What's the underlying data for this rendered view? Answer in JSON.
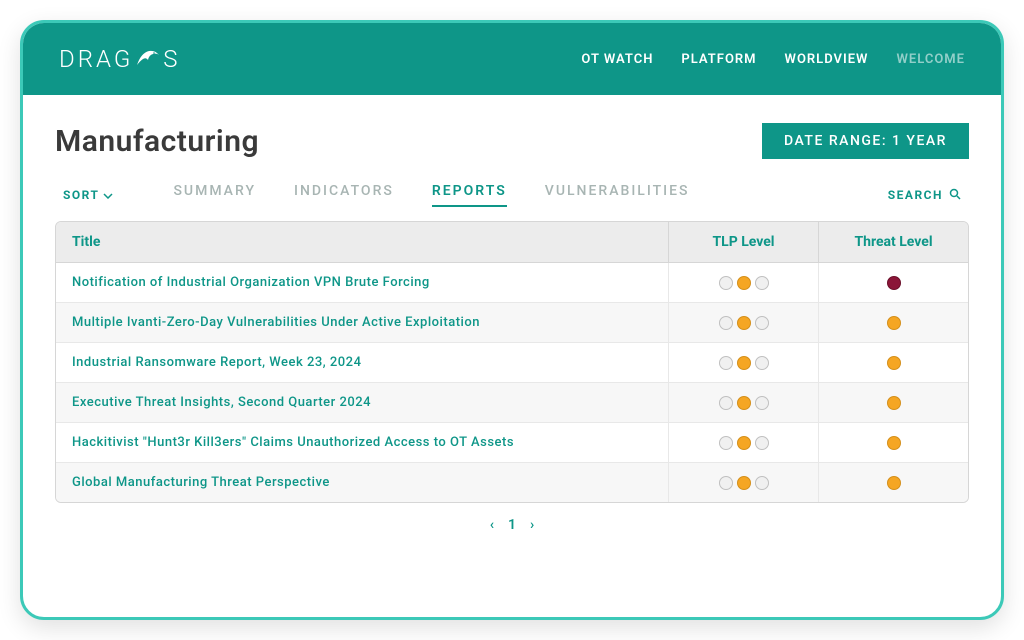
{
  "logo_text_1": "DRAG",
  "logo_text_2": "S",
  "nav": [
    {
      "label": "OT WATCH",
      "dim": false
    },
    {
      "label": "PLATFORM",
      "dim": false
    },
    {
      "label": "WORLDVIEW",
      "dim": false
    },
    {
      "label": "WELCOME",
      "dim": true
    }
  ],
  "page_title": "Manufacturing",
  "date_range": "DATE RANGE: 1 YEAR",
  "sort_label": "SORT",
  "tabs": [
    {
      "label": "SUMMARY",
      "active": false
    },
    {
      "label": "INDICATORS",
      "active": false
    },
    {
      "label": "REPORTS",
      "active": true
    },
    {
      "label": "VULNERABILITIES",
      "active": false
    }
  ],
  "search_label": "SEARCH",
  "columns": {
    "title": "Title",
    "tlp": "TLP Level",
    "threat": "Threat Level"
  },
  "rows": [
    {
      "title": "Notification of Industrial Organization VPN Brute Forcing",
      "tlp": [
        0,
        1,
        0
      ],
      "threat": "red"
    },
    {
      "title": "Multiple Ivanti-Zero-Day Vulnerabilities Under Active Exploitation",
      "tlp": [
        0,
        1,
        0
      ],
      "threat": "orange"
    },
    {
      "title": "Industrial Ransomware Report, Week 23, 2024",
      "tlp": [
        0,
        1,
        0
      ],
      "threat": "orange"
    },
    {
      "title": "Executive Threat Insights, Second Quarter 2024",
      "tlp": [
        0,
        1,
        0
      ],
      "threat": "orange"
    },
    {
      "title": "Hackitivist \"Hunt3r Kill3ers\" Claims Unauthorized Access to OT Assets",
      "tlp": [
        0,
        1,
        0
      ],
      "threat": "orange"
    },
    {
      "title": "Global Manufacturing Threat Perspective",
      "tlp": [
        0,
        1,
        0
      ],
      "threat": "orange"
    }
  ],
  "pager": {
    "prev": "‹",
    "current": "1",
    "next": "›"
  }
}
